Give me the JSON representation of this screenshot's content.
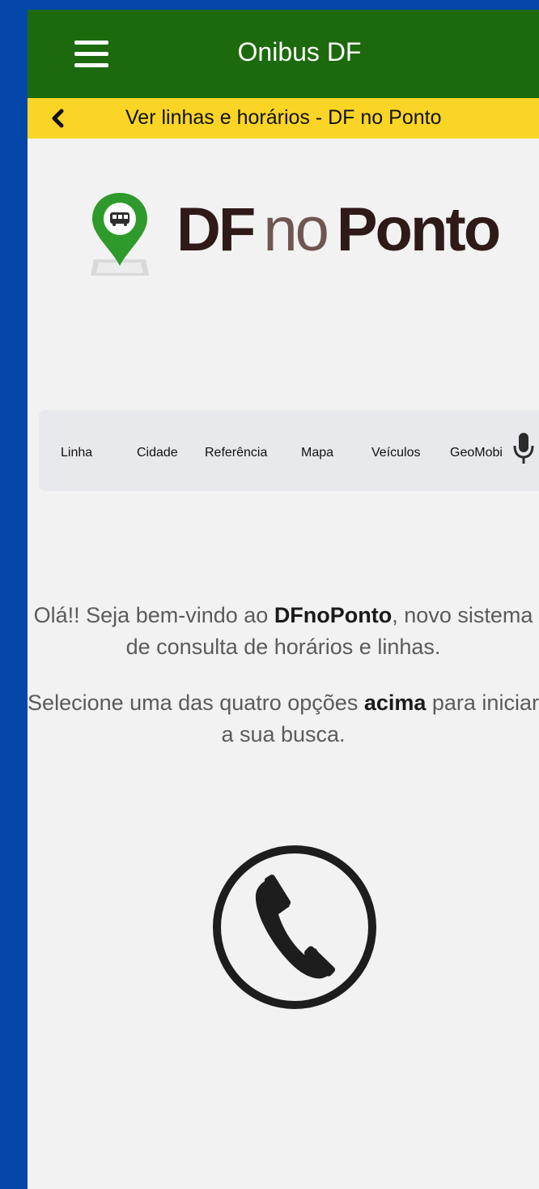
{
  "app_title": "Onibus DF",
  "subtitle": "Ver linhas e horários - DF no Ponto",
  "logo": {
    "df": "DF",
    "no": "no",
    "ponto": "Ponto"
  },
  "tabs": [
    {
      "label": "Linha"
    },
    {
      "label": "Cidade"
    },
    {
      "label": "Referência"
    },
    {
      "label": "Mapa"
    },
    {
      "label": "Veículos"
    },
    {
      "label": "GeoMobi"
    }
  ],
  "welcome": {
    "line1_prefix": "Olá!! Seja bem-vindo ao ",
    "line1_bold": "DFnoPonto",
    "line1_suffix": ", novo sistema de consulta de horários e linhas.",
    "line2_prefix": "Selecione uma das quatro opções ",
    "line2_bold": "acima",
    "line2_suffix": " para iniciar a sua busca."
  },
  "colors": {
    "topbar": "#1c6a0d",
    "subbar": "#fbd526",
    "frame": "#0447a8",
    "background": "#f2f2f2"
  },
  "icons": [
    "menu-icon",
    "chevron-left-icon",
    "bus-pin-icon",
    "microphone-icon",
    "phone-icon"
  ]
}
